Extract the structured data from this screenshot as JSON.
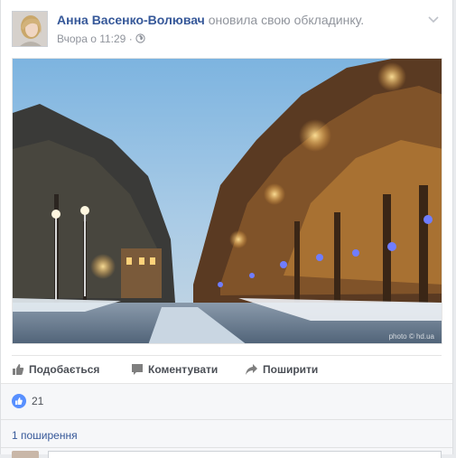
{
  "post": {
    "author": "Анна Васенко-Волювач",
    "action": "оновила свою обкладинку.",
    "timestamp": "Вчора о 11:29",
    "separator": " · ",
    "privacy_icon": "globe-icon",
    "menu_icon": "chevron-down-icon"
  },
  "photo": {
    "watermark": "photo © hd.ua"
  },
  "actions": {
    "like_label": "Подобається",
    "comment_label": "Коментувати",
    "share_label": "Поширити"
  },
  "reactions": {
    "like_count": "21"
  },
  "shares": {
    "label": "1 поширення"
  },
  "colors": {
    "link": "#365899",
    "meta": "#90949c",
    "like": "#5890ff"
  }
}
